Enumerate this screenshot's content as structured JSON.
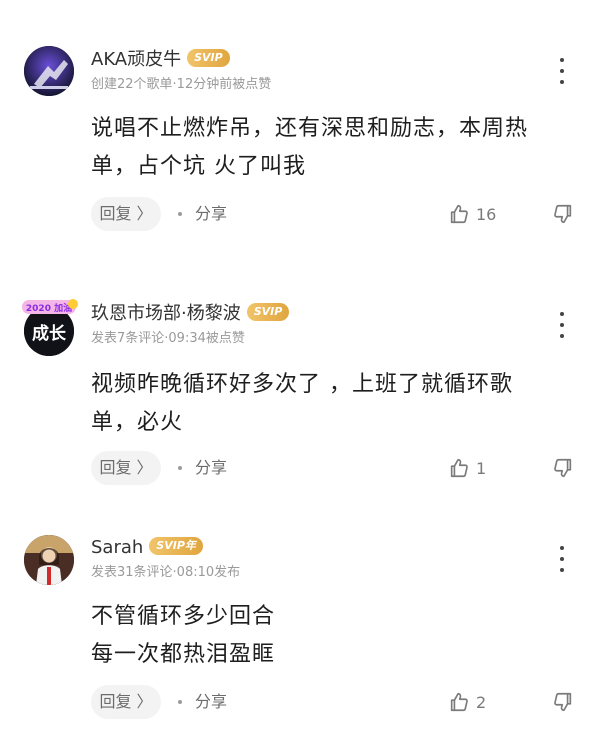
{
  "comments": [
    {
      "username": "AKA顽皮牛",
      "badge": "SVIP",
      "meta": "创建22个歌单·12分钟前被点赞",
      "text_lines": [
        "说唱不止燃炸吊，还有深思和励志，本周热",
        "单，占个坑 火了叫我"
      ],
      "reply_label": "回复 〉",
      "share_label": "分享",
      "like_count": "16"
    },
    {
      "username": "玖恩市场部·杨黎波",
      "badge": "SVIP",
      "meta": "发表7条评论·09:34被点赞",
      "text_lines": [
        "视频昨晚循环好多次了 ，上班了就循环歌",
        "单，必火"
      ],
      "reply_label": "回复 〉",
      "share_label": "分享",
      "like_count": "1"
    },
    {
      "username": "Sarah",
      "badge": "SVIP年",
      "meta": "发表31条评论·08:10发布",
      "text_lines": [
        "不管循环多少回合",
        "每一次都热泪盈眶"
      ],
      "reply_label": "回复 〉",
      "share_label": "分享",
      "like_count": "2"
    }
  ],
  "avatar_text": {
    "comment2_main": "成长",
    "comment2_small": "2020 加油"
  },
  "colors": {
    "svip_gold": "#e0a53e",
    "meta_gray": "#9a9a9a",
    "text_dark": "#1e1e1e"
  },
  "icons": [
    "more-options-icon",
    "thumbs-up-icon",
    "thumbs-down-icon"
  ]
}
